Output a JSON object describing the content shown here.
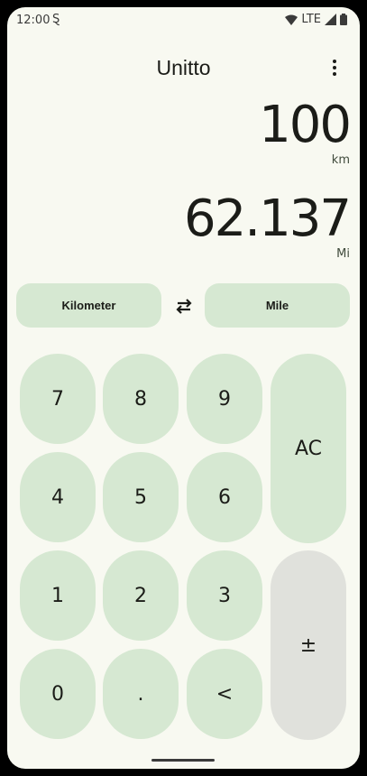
{
  "status": {
    "time": "12:00",
    "network": "LTE"
  },
  "app": {
    "title": "Unitto"
  },
  "input": {
    "value": "100",
    "unit": "km"
  },
  "output": {
    "value": "62.137",
    "unit": "Mi"
  },
  "units": {
    "from": "Kilometer",
    "to": "Mile"
  },
  "keys": {
    "k7": "7",
    "k8": "8",
    "k9": "9",
    "ac": "AC",
    "k4": "4",
    "k5": "5",
    "k6": "6",
    "k1": "1",
    "k2": "2",
    "k3": "3",
    "pm": "±",
    "k0": "0",
    "dot": ".",
    "back": "<"
  },
  "colors": {
    "accent": "#d6e8d2",
    "background": "#f8f9f1",
    "neutral_key": "#e0e1dc"
  }
}
